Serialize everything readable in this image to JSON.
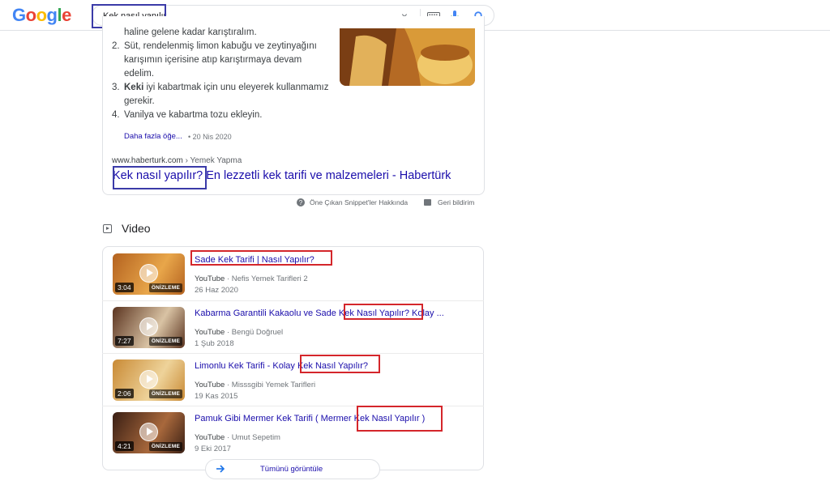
{
  "header": {
    "logo_letters": [
      {
        "ch": "G",
        "color": "#4285F4"
      },
      {
        "ch": "o",
        "color": "#EA4335"
      },
      {
        "ch": "o",
        "color": "#FBBC05"
      },
      {
        "ch": "g",
        "color": "#4285F4"
      },
      {
        "ch": "l",
        "color": "#34A853"
      },
      {
        "ch": "e",
        "color": "#EA4335"
      }
    ],
    "search_value": "Kek nasıl yapılır",
    "clear_glyph": "×"
  },
  "snippet": {
    "steps": [
      {
        "num": "",
        "parts": [
          {
            "t": "haline gelene kadar karıştıralım.",
            "b": false
          }
        ]
      },
      {
        "num": "2.",
        "parts": [
          {
            "t": "Süt, rendelenmiş limon kabuğu ve zeytinyağını karışımın içerisine atıp karıştırmaya devam edelim.",
            "b": false
          }
        ]
      },
      {
        "num": "3.",
        "parts": [
          {
            "t": "Keki",
            "b": true
          },
          {
            "t": " iyi kabartmak için unu eleyerek kullanmamız gerekir.",
            "b": false
          }
        ]
      },
      {
        "num": "4.",
        "parts": [
          {
            "t": "Vanilya ve kabartma tozu ekleyin.",
            "b": false
          }
        ]
      }
    ],
    "more_link": "Daha fazla öğe...",
    "date": "• 20 Nis 2020",
    "cite_domain": "www.haberturk.com",
    "cite_crumb": " › Yemek Yapma",
    "title": "Kek nasıl yapılır? En lezzetli kek tarifi ve malzemeleri - Habertürk",
    "footer_about": "Öne Çıkan Snippet'ler Hakkında",
    "footer_feedback": "Geri bildirim"
  },
  "video_section": {
    "heading": "Video",
    "see_all": "Tümünü görüntüle",
    "videos": [
      {
        "title": "Sade Kek Tarifi | Nasıl Yapılır?",
        "source": "YouTube",
        "channel": "· Nefis Yemek Tarifleri 2",
        "date": "26 Haz 2020",
        "duration": "3:04",
        "preview": "ÖNİZLEME",
        "c1": "#b4621f",
        "c2": "#e8a64a"
      },
      {
        "title": "Kabarma Garantili Kakaolu ve Sade Kek Nasıl Yapılır? Kolay ...",
        "source": "YouTube",
        "channel": "· Bengü Doğruel",
        "date": "1 Şub 2018",
        "duration": "7:27",
        "preview": "ÖNİZLEME",
        "c1": "#5b3420",
        "c2": "#d9c3a4"
      },
      {
        "title": "Limonlu Kek Tarifi - Kolay Kek Nasıl Yapılır?",
        "source": "YouTube",
        "channel": "· Misssgibi Yemek Tarifleri",
        "date": "19 Kas 2015",
        "duration": "2:06",
        "preview": "ÖNİZLEME",
        "c1": "#c98a35",
        "c2": "#eed39a"
      },
      {
        "title": "Pamuk Gibi Mermer Kek Tarifi ( Mermer Kek Nasıl Yapılır )",
        "source": "YouTube",
        "channel": "· Umut Sepetim",
        "date": "9 Eki 2017",
        "duration": "4:21",
        "preview": "ÖNİZLEME",
        "c1": "#3a1f14",
        "c2": "#a8683c"
      }
    ]
  },
  "colors": {
    "link": "#1a0dab",
    "annotation_blue": "#3b3ba8",
    "annotation_red": "#d4262b"
  },
  "icons": [
    "clear-icon",
    "keyboard-icon",
    "mic-icon",
    "magnifier-icon",
    "play-icon",
    "arrow-right-icon"
  ]
}
